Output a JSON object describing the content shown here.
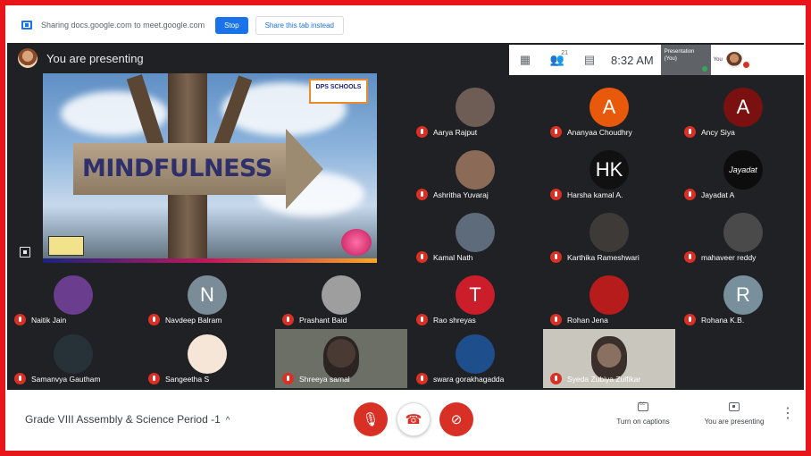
{
  "share_bar": {
    "message": "Sharing docs.google.com to meet.google.com",
    "stop_label": "Stop",
    "share_tab_label": "Share this tab instead"
  },
  "presenter": {
    "label": "You are presenting"
  },
  "topbar": {
    "people_count": "21",
    "time": "8:32 AM",
    "thumb_label": "Presentation (You)",
    "you_label": "You"
  },
  "slide": {
    "sign_text": "MINDFULNESS",
    "logo_text": "DPS SCHOOLS"
  },
  "participants": [
    {
      "name": "Aarya Rajput",
      "initial": "",
      "color": "#6d5d55"
    },
    {
      "name": "Ananyaa Choudhry",
      "initial": "A",
      "color": "#e8590c"
    },
    {
      "name": "Ancy Siya",
      "initial": "A",
      "color": "#7a1010"
    },
    {
      "name": "Ashritha Yuvaraj",
      "initial": "",
      "color": "#8b6a58"
    },
    {
      "name": "Harsha kamal A.",
      "initial": "HK",
      "color": "#111111"
    },
    {
      "name": "Jayadat A",
      "initial": "Jayadat",
      "color": "#0d0d0d"
    },
    {
      "name": "Kamal Nath",
      "initial": "",
      "color": "#5d6b7a"
    },
    {
      "name": "Karthika Rameshwari",
      "initial": "",
      "color": "#3e3a38"
    },
    {
      "name": "mahaveer reddy",
      "initial": "",
      "color": "#4a4a4a"
    },
    {
      "name": "Naitik Jain",
      "initial": "",
      "color": "#6a3d8f"
    },
    {
      "name": "Navdeep Balram",
      "initial": "N",
      "color": "#7b8c99"
    },
    {
      "name": "Prashant Baid",
      "initial": "",
      "color": "#9e9e9e"
    },
    {
      "name": "Rao shreyas",
      "initial": "T",
      "color": "#cc1d2b"
    },
    {
      "name": "Rohan Jena",
      "initial": "",
      "color": "#b71c1c"
    },
    {
      "name": "Rohana K.B.",
      "initial": "R",
      "color": "#78909c"
    },
    {
      "name": "Samanvya Gautham",
      "initial": "",
      "color": "#263238"
    },
    {
      "name": "Sangeetha S",
      "initial": "",
      "color": "#f5e6d8"
    },
    {
      "name": "Shreeya samal",
      "initial": "",
      "color": "#6b6f66"
    },
    {
      "name": "swara gorakhagadda",
      "initial": "",
      "color": "#1e4e8c"
    },
    {
      "name": "Syeda Zubiya Zulfikar",
      "initial": "",
      "color": "#c9c6be"
    }
  ],
  "bottom_bar": {
    "meeting_title": "Grade VIII Assembly & Science Period -1",
    "captions_label": "Turn on captions",
    "presenting_label": "You are presenting"
  }
}
